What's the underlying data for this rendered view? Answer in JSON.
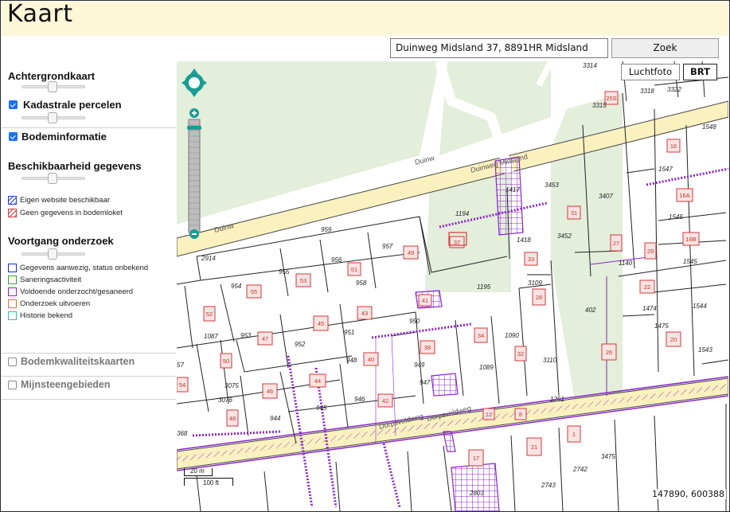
{
  "header": {
    "title": "Kaart"
  },
  "search": {
    "value": "Duinweg Midsland 37, 8891HR Midsland",
    "button_label": "Zoek"
  },
  "sidebar": {
    "achtergrondkaart": {
      "label": "Achtergrondkaart"
    },
    "kadastrale": {
      "label": "Kadastrale percelen",
      "checked": true
    },
    "bodeminformatie": {
      "label": "Bodeminformatie",
      "checked": true
    },
    "beschikbaarheid": {
      "label": "Beschikbaarheid gegevens"
    },
    "beschikbaarheid_legend": [
      {
        "label": "Eigen website beschikbaar",
        "color": "#1f3fbf"
      },
      {
        "label": "Geen gegevens in bodemloket",
        "color": "#d33a3a"
      }
    ],
    "voortgang": {
      "label": "Voortgang onderzoek"
    },
    "voortgang_legend": [
      {
        "label": "Gegevens aanwezig, status onbekend",
        "color": "#1b2bd0"
      },
      {
        "label": "Saneringsactiviteit",
        "color": "#2aa52a"
      },
      {
        "label": "Voldoende onderzocht/gesaneerd",
        "color": "#8b24c9"
      },
      {
        "label": "Onderzoek uitvoeren",
        "color": "#e07b1c"
      },
      {
        "label": "Historie bekend",
        "color": "#28c2c2"
      }
    ],
    "bodemkwaliteit": {
      "label": "Bodemkwaliteitskaarten",
      "checked": false
    },
    "mijnsteen": {
      "label": "Mijnsteengebieden",
      "checked": false
    }
  },
  "map": {
    "buttons": {
      "luchtfoto": "Luchtfoto",
      "brt": "BRT"
    },
    "coordinates": "147890, 600388",
    "scale": {
      "meters": "20 m",
      "feet": "100 ft"
    },
    "streets": [
      {
        "name": "Duinweg Midsland"
      },
      {
        "name": "Duinw"
      },
      {
        "name": "Duinw"
      },
      {
        "name": "Dorpsveldweg"
      },
      {
        "name": "Dorpsveldweg"
      }
    ],
    "parcel_numbers": [
      "3314",
      "3315",
      "3318",
      "3322",
      "1548",
      "1547",
      "1546",
      "1545",
      "1544",
      "1543",
      "3453",
      "3407",
      "3452",
      "1140",
      "1474",
      "1475",
      "1417",
      "1418",
      "1194",
      "1195",
      "3109",
      "402",
      "959",
      "954",
      "955",
      "956",
      "957",
      "958",
      "953",
      "952",
      "951",
      "950",
      "949",
      "948",
      "947",
      "946",
      "945",
      "944",
      "1087",
      "1089",
      "1090",
      "3110",
      "1251",
      "2914",
      "3075",
      "3076",
      "2742",
      "2743",
      "3475",
      "2803",
      "368",
      "57"
    ],
    "house_numbers": [
      "25S",
      "16",
      "16A",
      "16B",
      "31",
      "29",
      "27",
      "22",
      "20",
      "26",
      "33",
      "28",
      "37",
      "49",
      "51",
      "53",
      "55",
      "52",
      "47",
      "45",
      "43",
      "41",
      "40",
      "44",
      "46",
      "42",
      "38",
      "34",
      "32",
      "48",
      "50",
      "54",
      "17",
      "1",
      "21",
      "12",
      "8"
    ]
  }
}
